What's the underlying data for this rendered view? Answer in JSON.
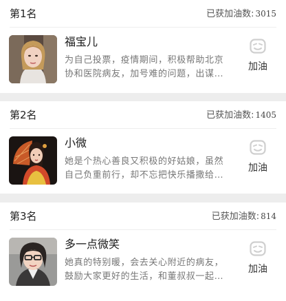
{
  "items": [
    {
      "rank": "第1名",
      "score_label": "已获加油数:",
      "score_value": "3015",
      "name": "福宝儿",
      "description": "为自己投票，疫情期间，积极帮助北京协和医院病友，加号难的问题，出谋…",
      "cheer_label": "加油",
      "avatar_icon": "woman-portrait"
    },
    {
      "rank": "第2名",
      "score_label": "已获加油数:",
      "score_value": "1405",
      "name": "小微",
      "description": "她是个热心善良又积极的好姑娘，虽然自己负重前行，却不忘把快乐播撒给…",
      "cheer_label": "加油",
      "avatar_icon": "girl-with-fan-portrait"
    },
    {
      "rank": "第3名",
      "score_label": "已获加油数:",
      "score_value": "814",
      "name": "多一点微笑",
      "description": "她真的特别暖，会去关心附近的病友，鼓励大家更好的生活，和董叔叔一起…",
      "cheer_label": "加油",
      "avatar_icon": "woman-with-glasses-portrait"
    }
  ]
}
